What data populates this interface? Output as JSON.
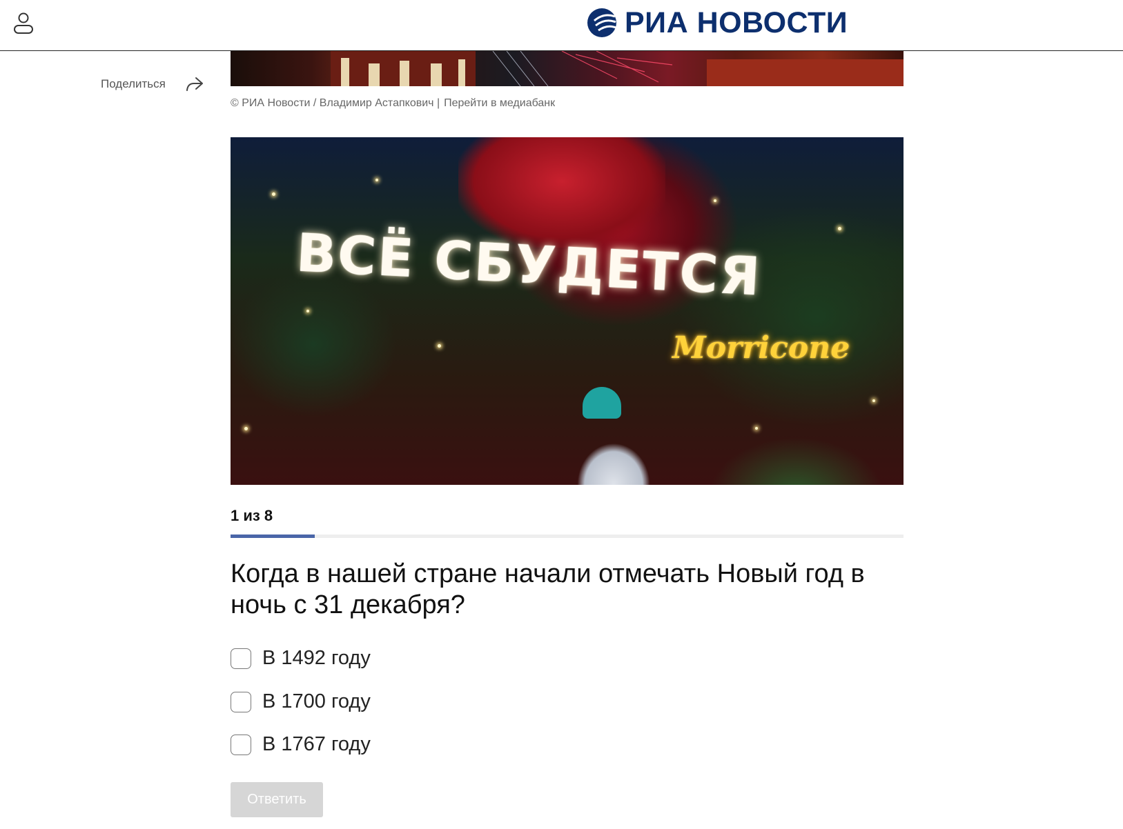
{
  "header": {
    "logo_text": "РИА НОВОСТИ",
    "brand_color": "#0d2f6e",
    "user_icon": "user-icon"
  },
  "share": {
    "label": "Поделиться",
    "icon": "share-arrow-icon"
  },
  "top_photo": {
    "caption_credit": "© РИА Новости / Владимир Астапкович |",
    "caption_link": "Перейти в медиабанк"
  },
  "main_photo": {
    "sign_text": "ВСЁ СБУДЕТСЯ",
    "neon_text": "Morricone"
  },
  "quiz": {
    "counter": "1 из 8",
    "progress": 0.125,
    "progress_color": "#4a66a8",
    "question": "Когда в нашей стране начали отмечать Новый год в ночь с 31 декабря?",
    "options": [
      {
        "label": "В 1492 году"
      },
      {
        "label": "В 1700 году"
      },
      {
        "label": "В 1767 году"
      }
    ],
    "submit_label": "Ответить"
  }
}
